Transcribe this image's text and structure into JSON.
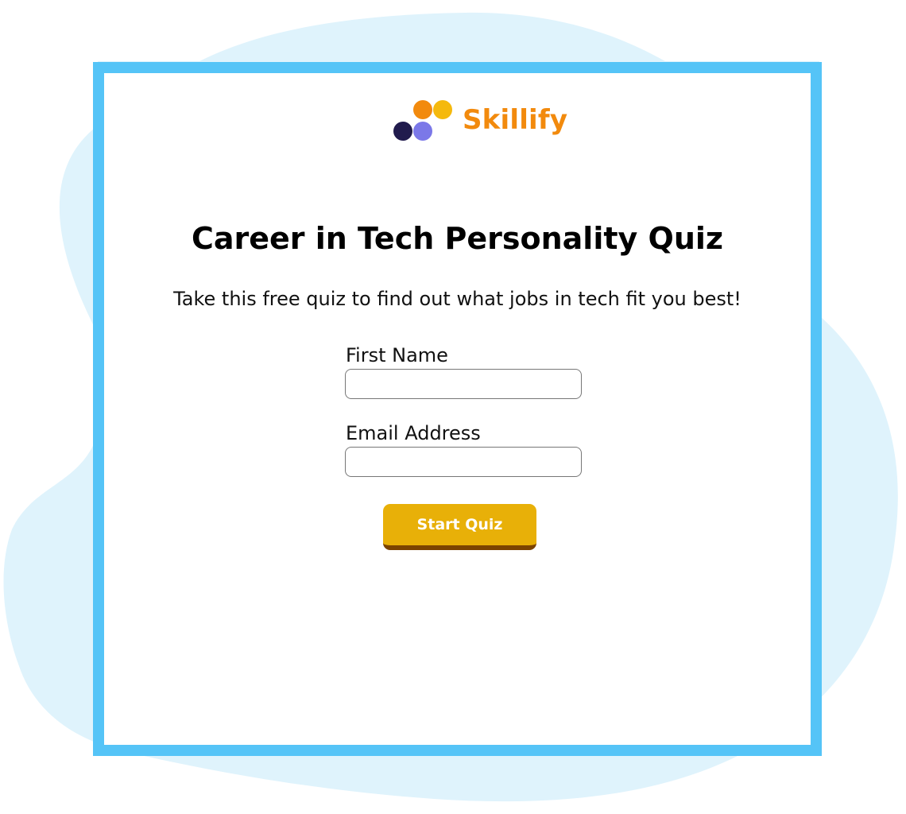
{
  "brand": {
    "name": "Skillify",
    "logo_icon": "four-dot-logo-icon",
    "colors": {
      "orange": "#f28a0d",
      "yellow": "#f5b90d",
      "navy": "#211b4d",
      "purple": "#7b78e8"
    }
  },
  "quiz": {
    "title": "Career in Tech Personality Quiz",
    "subtitle": "Take this free quiz to find out what jobs in tech fit you best!"
  },
  "form": {
    "first_name": {
      "label": "First Name",
      "value": "",
      "placeholder": ""
    },
    "email": {
      "label": "Email Address",
      "value": "",
      "placeholder": ""
    },
    "submit_label": "Start Quiz"
  },
  "theme": {
    "frame_color": "#55c4f7",
    "background_blob_color": "#dff3fc",
    "button_color": "#e8b008",
    "button_shadow_color": "#7b4300"
  }
}
